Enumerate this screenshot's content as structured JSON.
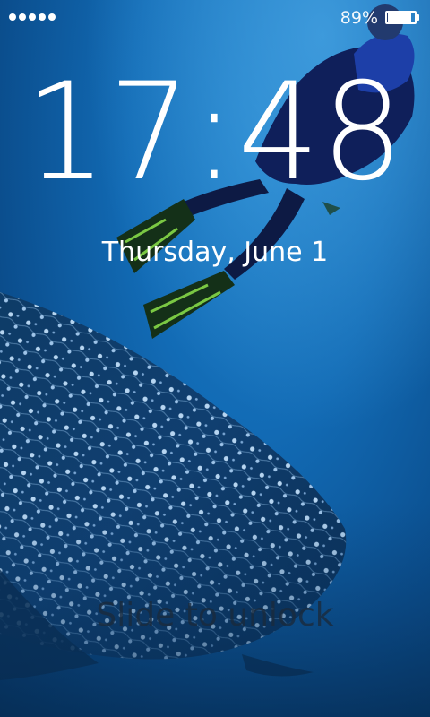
{
  "status_bar": {
    "battery_percent_text": "89%",
    "battery_level": 0.89,
    "signal_dots": 5
  },
  "lock_screen": {
    "time": "17:48",
    "date": "Thursday, June 1",
    "unlock_hint": "Slide to unlock"
  },
  "wallpaper": {
    "subject": "whale-shark-and-diver"
  },
  "colors": {
    "water_top": "#1e7ec7",
    "water_deep": "#073868",
    "text": "#ffffff",
    "fin_accent": "#7ac843"
  }
}
